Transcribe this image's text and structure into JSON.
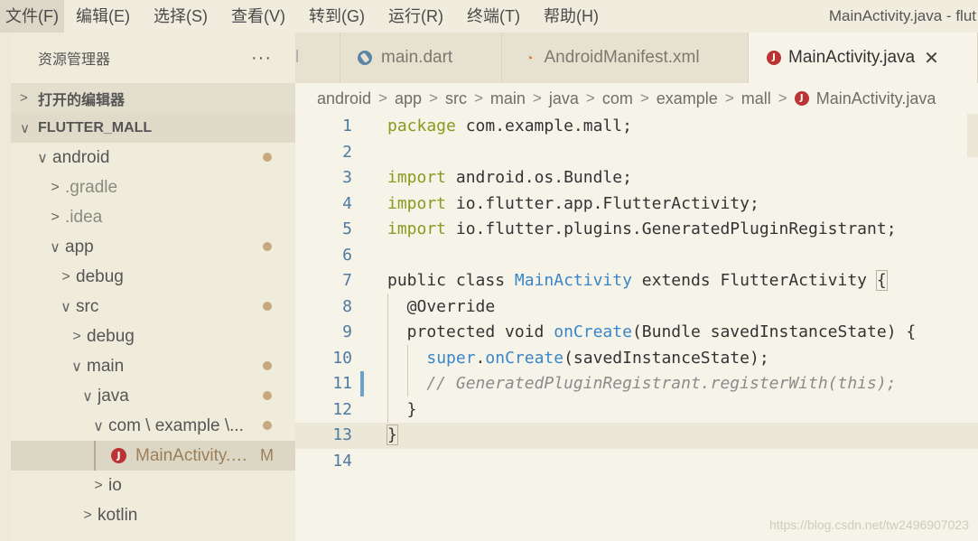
{
  "menubar": {
    "items": [
      "文件(F)",
      "编辑(E)",
      "选择(S)",
      "查看(V)",
      "转到(G)",
      "运行(R)",
      "终端(T)",
      "帮助(H)"
    ],
    "window_title": "MainActivity.java - flut"
  },
  "sidebar": {
    "title": "资源管理器",
    "more": "···",
    "open_editors": "打开的编辑器",
    "project": "FLUTTER_MALL",
    "tree": [
      {
        "label": "android",
        "chev": "∨",
        "dot": true
      },
      {
        "label": ".gradle",
        "chev": ">",
        "dot": false
      },
      {
        "label": ".idea",
        "chev": ">",
        "dot": false
      },
      {
        "label": "app",
        "chev": "∨",
        "dot": true
      },
      {
        "label": "debug",
        "chev": ">",
        "dot": false
      },
      {
        "label": "src",
        "chev": "∨",
        "dot": true
      },
      {
        "label": "debug",
        "chev": ">",
        "dot": false
      },
      {
        "label": "main",
        "chev": "∨",
        "dot": true
      },
      {
        "label": "java",
        "chev": "∨",
        "dot": true
      },
      {
        "label": "com \\ example \\...",
        "chev": "∨",
        "dot": true
      },
      {
        "label": "MainActivity.ja...",
        "badge": "J",
        "mod": "M"
      },
      {
        "label": "io",
        "chev": ">",
        "dot": false
      },
      {
        "label": "kotlin",
        "chev": ">",
        "dot": false
      }
    ]
  },
  "tabs": {
    "partial": "l",
    "items": [
      {
        "label": "main.dart",
        "icon": "dart-icon"
      },
      {
        "label": "AndroidManifest.xml",
        "icon": "rss-icon"
      },
      {
        "label": "MainActivity.java",
        "icon": "java-icon",
        "close": "✕"
      }
    ]
  },
  "breadcrumb": [
    "android",
    "app",
    "src",
    "main",
    "java",
    "com",
    "example",
    "mall",
    "MainActivity.java"
  ],
  "code": {
    "line_numbers": [
      "1",
      "2",
      "3",
      "4",
      "5",
      "6",
      "7",
      "8",
      "9",
      "10",
      "11",
      "12",
      "13",
      "14"
    ]
  },
  "watermark": "https://blog.csdn.net/tw2496907023"
}
